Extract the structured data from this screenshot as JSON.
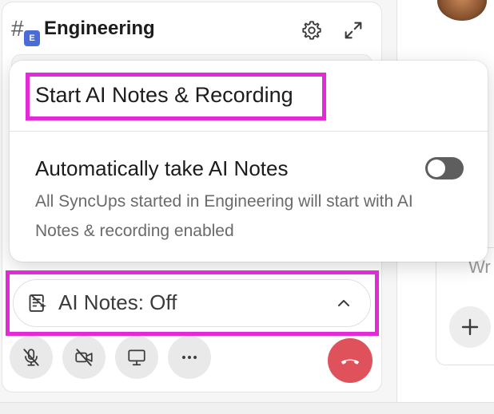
{
  "channel": {
    "badge": "E",
    "name": "Engineering"
  },
  "popover": {
    "start_label": "Start AI Notes & Recording",
    "auto_title": "Automatically take AI Notes",
    "auto_description": "All SyncUps started in Engineering will start with AI Notes & recording enabled",
    "auto_toggle_on": false
  },
  "ai_notes": {
    "label": "AI Notes: Off"
  },
  "right_panel": {
    "text": "Wr"
  },
  "colors": {
    "highlight": "#e22ad6",
    "badge": "#4a6cd8",
    "hangup": "#e0525b",
    "toggle_off": "#5e5e5e"
  },
  "icons": {
    "channel": "hash-icon",
    "settings": "gear-icon",
    "expand": "expand-icon",
    "notes": "ai-notes-icon",
    "chevron": "chevron-up-icon",
    "mic": "mic-off-icon",
    "camera": "camera-off-icon",
    "screen": "screen-share-icon",
    "more": "more-icon",
    "hangup": "hangup-icon",
    "add": "plus-icon"
  }
}
